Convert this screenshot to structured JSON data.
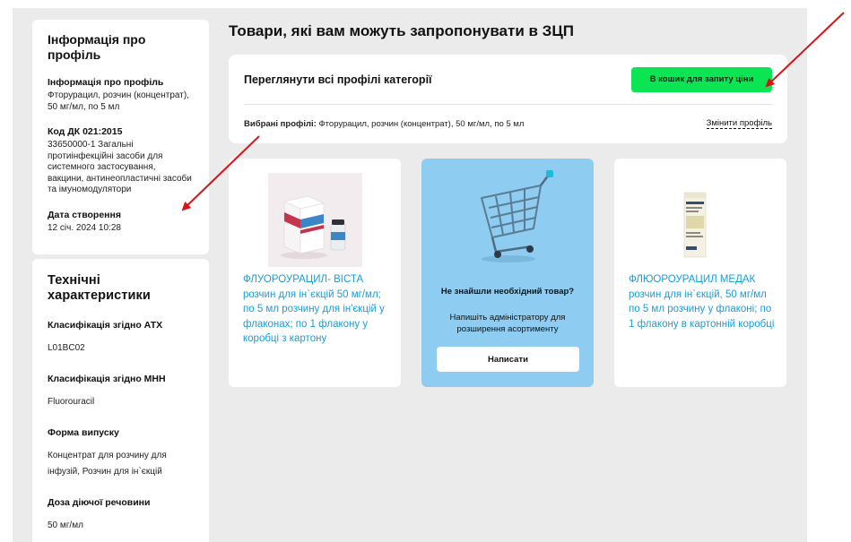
{
  "sidebar": {
    "profile_info": {
      "title": "Інформація про профіль",
      "fields": [
        {
          "label": "Інформація про профіль",
          "value": "Фторурацил, розчин (концентрат), 50 мг/мл, по 5 мл"
        },
        {
          "label": "Код ДК 021:2015",
          "value": "33650000-1 Загальні протиінфекційні засоби для системного застосування, вакцини, антинеопластичні засоби та імуномодулятори"
        },
        {
          "label": "Дата створення",
          "value": "12 січ. 2024 10:28"
        }
      ]
    },
    "tech_specs": {
      "title": "Технічні характеристики",
      "fields": [
        {
          "label": "Класифікація згідно АТХ",
          "value": "L01BC02"
        },
        {
          "label": "Класифікація згідно МНН",
          "value": "Fluorouracil"
        },
        {
          "label": "Форма випуску",
          "value": "Концентрат для розчину для інфузій, Розчин для ін`єкцій"
        },
        {
          "label": "Доза діючої речовини",
          "value": "50 мг/мл"
        }
      ]
    }
  },
  "main": {
    "title": "Товари, які вам можуть запропонувати в ЗЦП",
    "panel": {
      "heading": "Переглянути всі профілі категорії",
      "cart_button": "В кошик для запиту ціни",
      "selected_label": "Вибрані профілі:",
      "selected_value": "Фторурацил, розчин (концентрат), 50 мг/мл, по 5 мл",
      "change_link": "Змінити профіль"
    },
    "products": [
      {
        "name": "ФЛУОРОУРАЦИЛ- ВІСТА розчин для ін`єкцій 50 мг/мл; по 5 мл розчину для ін'єкцій у флаконах; по 1 флакону у коробці з картону"
      },
      {
        "name": "ФЛЮОРОУРАЦИЛ МЕДАК розчин для ін`єкцій, 50 мг/мл по 5 мл розчину у флаконі; по 1 флакону в картонній коробці"
      }
    ],
    "not_found": {
      "title": "Не знайшли необхідний товар?",
      "text": "Напишіть адміністратору для розширення асортименту",
      "button": "Написати"
    }
  },
  "colors": {
    "accent_green": "#0be553",
    "link_blue": "#1a9cd8",
    "promo_blue": "#8ecdf1",
    "annotation_red": "#d8141a"
  }
}
